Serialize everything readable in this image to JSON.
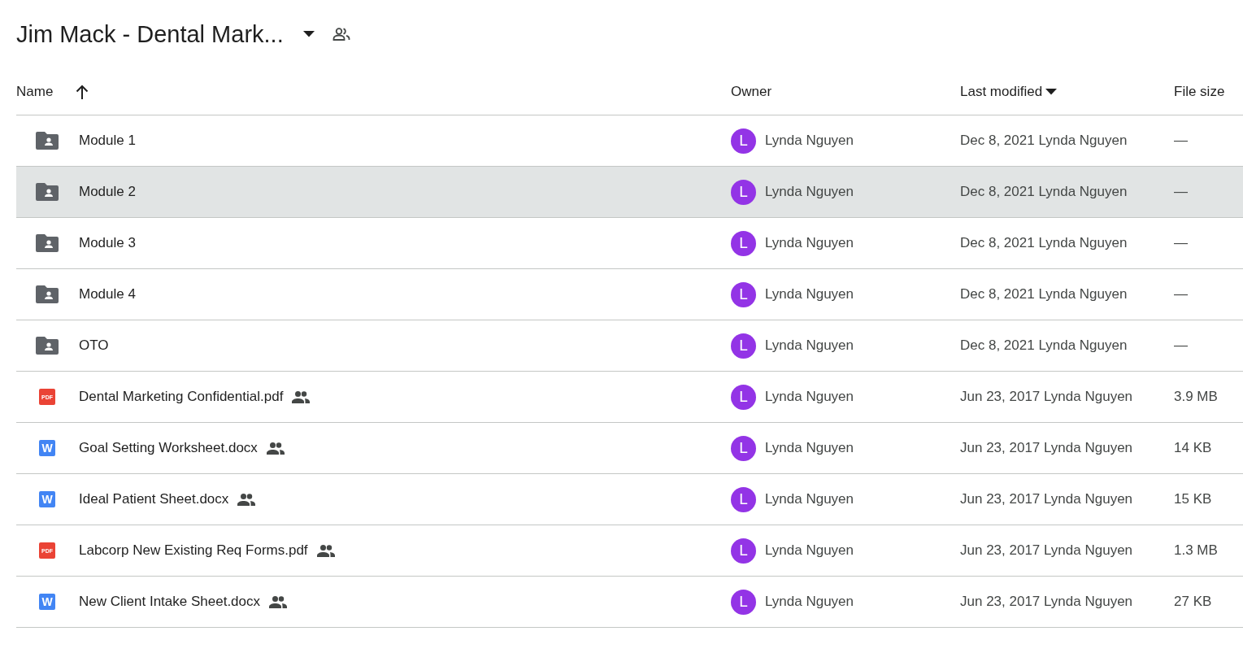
{
  "header": {
    "title": "Jim Mack - Dental Mark..."
  },
  "columns": [
    {
      "label": "Name",
      "sorted": true
    },
    {
      "label": "Owner",
      "sorted": false
    },
    {
      "label": "Last modified",
      "sorted": true
    },
    {
      "label": "File size",
      "sorted": false
    }
  ],
  "rows": [
    {
      "kind": "folder",
      "name": "Module 1",
      "shared": false,
      "selected": false,
      "owner_initial": "L",
      "owner": "Lynda Nguyen",
      "modified": "Dec 8, 2021 Lynda Nguyen",
      "size": "—"
    },
    {
      "kind": "folder",
      "name": "Module 2",
      "shared": false,
      "selected": true,
      "owner_initial": "L",
      "owner": "Lynda Nguyen",
      "modified": "Dec 8, 2021 Lynda Nguyen",
      "size": "—"
    },
    {
      "kind": "folder",
      "name": "Module 3",
      "shared": false,
      "selected": false,
      "owner_initial": "L",
      "owner": "Lynda Nguyen",
      "modified": "Dec 8, 2021 Lynda Nguyen",
      "size": "—"
    },
    {
      "kind": "folder",
      "name": "Module 4",
      "shared": false,
      "selected": false,
      "owner_initial": "L",
      "owner": "Lynda Nguyen",
      "modified": "Dec 8, 2021 Lynda Nguyen",
      "size": "—"
    },
    {
      "kind": "folder",
      "name": "OTO",
      "shared": false,
      "selected": false,
      "owner_initial": "L",
      "owner": "Lynda Nguyen",
      "modified": "Dec 8, 2021 Lynda Nguyen",
      "size": "—"
    },
    {
      "kind": "pdf",
      "type_label": "PDF",
      "name": "Dental Marketing Confidential.pdf",
      "shared": true,
      "selected": false,
      "owner_initial": "L",
      "owner": "Lynda Nguyen",
      "modified": "Jun 23, 2017 Lynda Nguyen",
      "size": "3.9 MB"
    },
    {
      "kind": "doc",
      "type_label": "W",
      "name": "Goal Setting Worksheet.docx",
      "shared": true,
      "selected": false,
      "owner_initial": "L",
      "owner": "Lynda Nguyen",
      "modified": "Jun 23, 2017 Lynda Nguyen",
      "size": "14 KB"
    },
    {
      "kind": "doc",
      "type_label": "W",
      "name": "Ideal Patient Sheet.docx",
      "shared": true,
      "selected": false,
      "owner_initial": "L",
      "owner": "Lynda Nguyen",
      "modified": "Jun 23, 2017 Lynda Nguyen",
      "size": "15 KB"
    },
    {
      "kind": "pdf",
      "type_label": "PDF",
      "name": "Labcorp New Existing Req Forms.pdf",
      "shared": true,
      "selected": false,
      "owner_initial": "L",
      "owner": "Lynda Nguyen",
      "modified": "Jun 23, 2017 Lynda Nguyen",
      "size": "1.3 MB"
    },
    {
      "kind": "doc",
      "type_label": "W",
      "name": "New Client Intake Sheet.docx",
      "shared": true,
      "selected": false,
      "owner_initial": "L",
      "owner": "Lynda Nguyen",
      "modified": "Jun 23, 2017 Lynda Nguyen",
      "size": "27 KB"
    }
  ]
}
